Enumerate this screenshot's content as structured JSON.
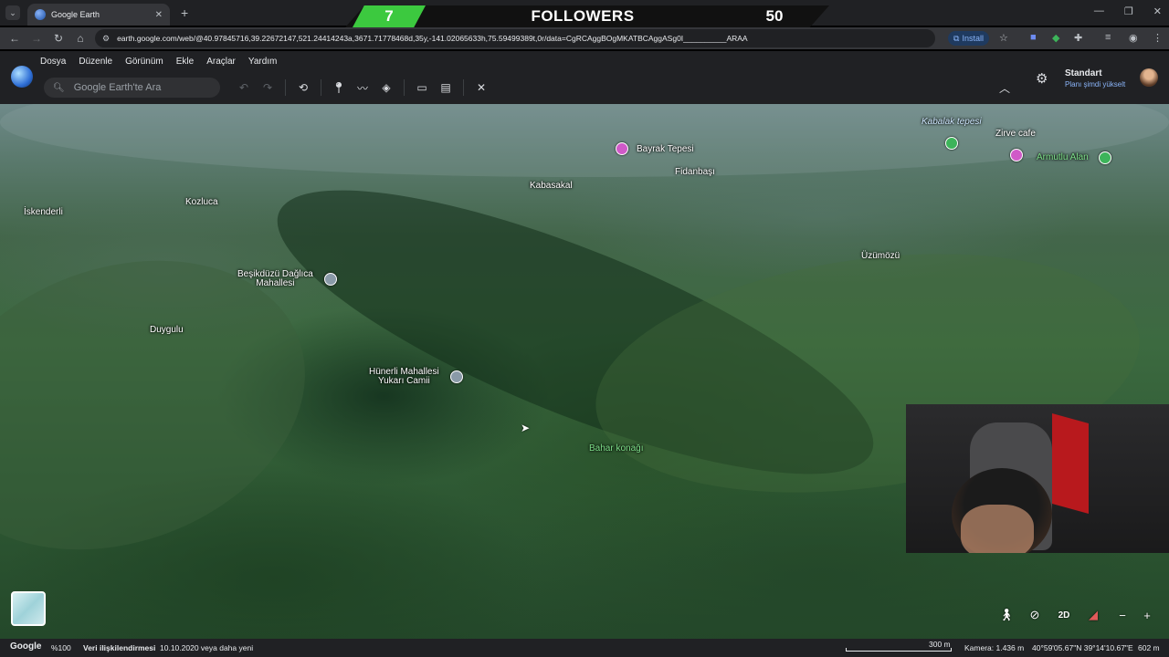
{
  "browser": {
    "tab_title": "Google Earth",
    "url": "earth.google.com/web/@40.97845716,39.22672147,521.24414243a,3671.71778468d,35y,-141.02065633h,75.59499389t,0r/data=CgRCAggBOgMKATBCAggASg0I__________ARAA",
    "install_label": "Install"
  },
  "overlay": {
    "left_count": "7",
    "label": "FOLLOWERS",
    "right_count": "50",
    "accent": "#3cc93f"
  },
  "menu": [
    "Dosya",
    "Düzenle",
    "Görünüm",
    "Ekle",
    "Araçlar",
    "Yardım"
  ],
  "search": {
    "placeholder": "Google Earth'te Ara"
  },
  "toolbar_icons": [
    "undo-icon",
    "redo-icon",
    "history-icon",
    "placemark-icon",
    "path-icon",
    "layers-icon",
    "measure-icon",
    "chart-icon",
    "tools-icon"
  ],
  "account": {
    "name": "Standart",
    "plan": "Planı şimdi yükselt"
  },
  "map_labels": {
    "iskenderli": "İskenderli",
    "kozluca": "Kozluca",
    "besikduzu_1": "Beşikdüzü Dağlıca",
    "besikduzu_2": "Mahallesi",
    "duygulu": "Duygulu",
    "hunerli_1": "Hünerli Mahallesi",
    "hunerli_2": "Yukarı Camii",
    "bahar": "Bahar konağı",
    "bayrak": "Bayrak Tepesi",
    "fidanbasi": "Fidanbaşı",
    "kabasakal": "Kabasakal",
    "uzumozu": "Üzümözü",
    "kabalak": "Kabalak tepesi",
    "zirve": "Zirve cafe",
    "armutlu": "Armutlu Alan"
  },
  "map_controls": {
    "mode_2d": "2D"
  },
  "status": {
    "google": "Google",
    "zoom": "%100",
    "data_attr": "Veri ilişkilendirmesi",
    "date": "10.10.2020 veya daha yeni",
    "scale": "300 m",
    "camera": "Kamera: 1.436 m",
    "coords": "40°59'05.67\"N 39°14'10.67\"E",
    "elevation": "602 m"
  }
}
